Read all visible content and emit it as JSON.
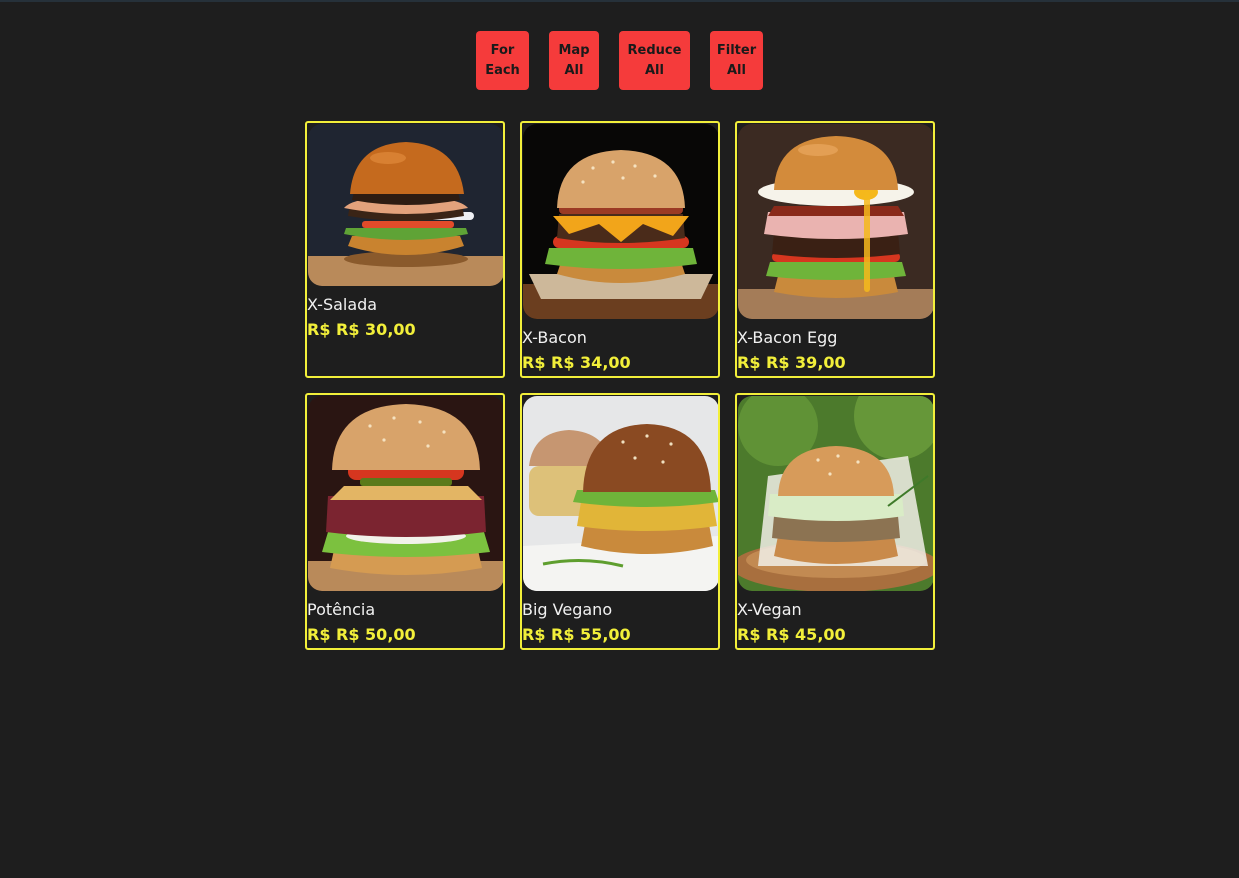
{
  "buttons": {
    "for_each": "For\nEach",
    "map_all": "Map\nAll",
    "reduce_all": "Reduce\nAll",
    "filter_all": "Filter\nAll"
  },
  "products": [
    {
      "name": "X-Salada",
      "price": "R$ R$ 30,00",
      "image": "burger-photo",
      "bg": "#1f2531"
    },
    {
      "name": "X-Bacon",
      "price": "R$ R$ 34,00",
      "image": "burger-photo",
      "bg": "#080706"
    },
    {
      "name": "X-Bacon Egg",
      "price": "R$ R$ 39,00",
      "image": "burger-photo",
      "bg": "#3b2a22"
    },
    {
      "name": "Potência",
      "price": "R$ R$ 50,00",
      "image": "burger-photo",
      "bg": "#2a1512"
    },
    {
      "name": "Big Vegano",
      "price": "R$ R$ 55,00",
      "image": "burger-photo",
      "bg": "#e6e7e8"
    },
    {
      "name": "X-Vegan",
      "price": "R$ R$ 45,00",
      "image": "burger-photo",
      "bg": "#4c7a2c"
    }
  ],
  "colors": {
    "background": "#1e1e1e",
    "button": "#f53b3b",
    "card_border": "#f2ef3a",
    "price": "#f2ef3a"
  }
}
